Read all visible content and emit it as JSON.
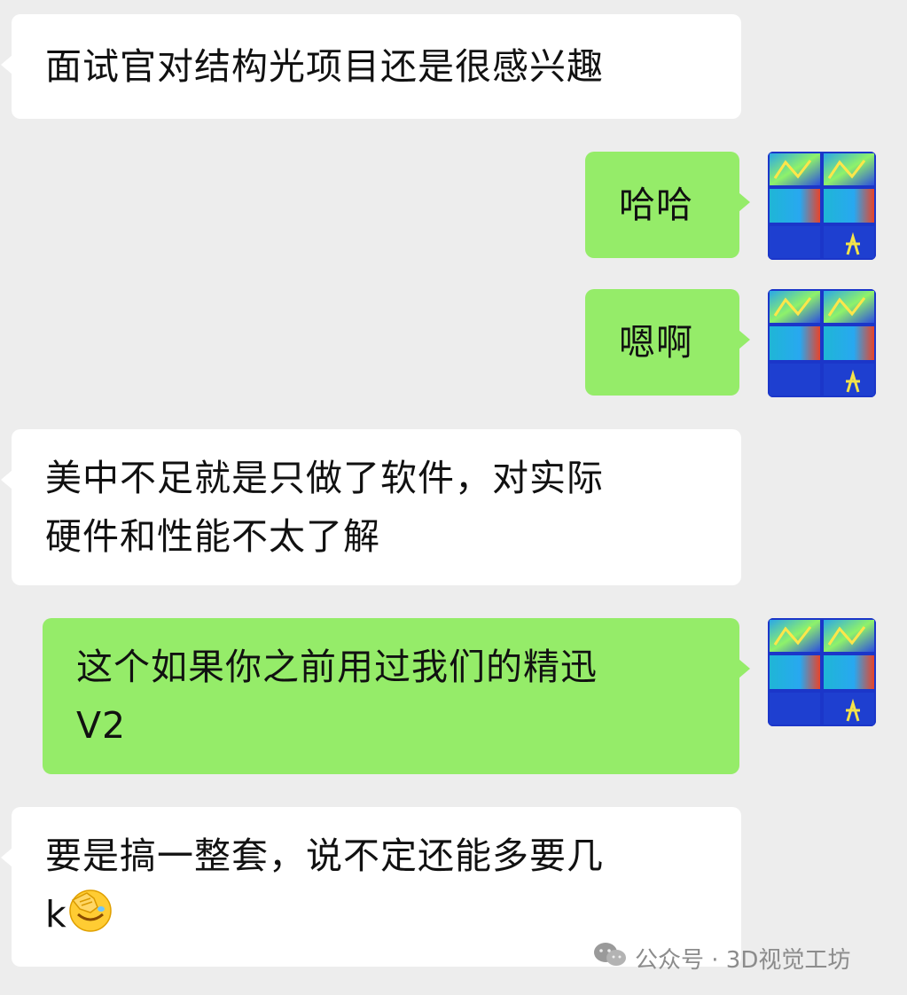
{
  "messages": [
    {
      "side": "in",
      "text": "面试官对结构光项目还是很感兴趣"
    },
    {
      "side": "out",
      "text": "哈哈",
      "avatar_icon": "depth-map-avatar"
    },
    {
      "side": "out",
      "text": "嗯啊",
      "avatar_icon": "depth-map-avatar"
    },
    {
      "side": "in",
      "lines": [
        "美中不足就是只做了软件，对实际",
        "硬件和性能不太了解"
      ]
    },
    {
      "side": "out",
      "lines": [
        "这个如果你之前用过我们的精迅",
        "V2"
      ],
      "avatar_icon": "depth-map-avatar"
    },
    {
      "side": "in",
      "lines": [
        "要是搞一整套，说不定还能多要几",
        "k"
      ],
      "trailing_emoji": "facepalm-emoji"
    }
  ],
  "watermark": {
    "text": "公众号 · 3D视觉工坊",
    "icon": "wechat-icon"
  },
  "colors": {
    "background": "#ededed",
    "incoming_bubble": "#ffffff",
    "outgoing_bubble": "#95ec69",
    "watermark_text": "#8c8c8c"
  }
}
